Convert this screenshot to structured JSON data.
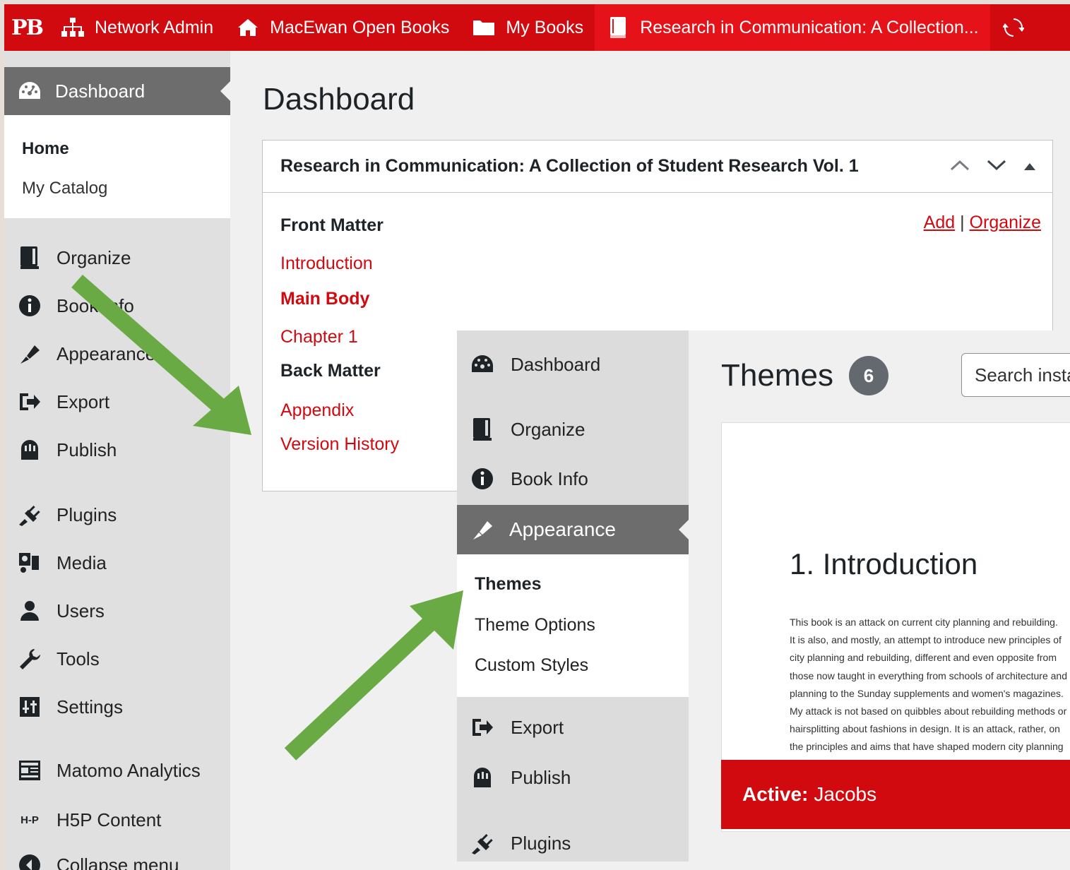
{
  "colors": {
    "brand": "#d10a10",
    "arrow": "#6aaa44",
    "menu_active": "#6d6d6d"
  },
  "adminbar": {
    "logo": "PB",
    "items": [
      {
        "label": "Network Admin",
        "icon": "sitemap-icon"
      },
      {
        "label": "MacEwan Open Books",
        "icon": "home-icon"
      },
      {
        "label": "My Books",
        "icon": "folder-icon"
      },
      {
        "label": "Research in Communication: A Collection...",
        "icon": "book-icon"
      }
    ],
    "trailing_icon": "sync-icon"
  },
  "sidebar": {
    "active": {
      "label": "Dashboard",
      "icon": "dashboard-icon"
    },
    "submenu": [
      "Home",
      "My Catalog"
    ],
    "items": [
      {
        "label": "Organize",
        "icon": "book-icon"
      },
      {
        "label": "Book Info",
        "icon": "info-icon"
      },
      {
        "label": "Appearance",
        "icon": "brush-icon"
      },
      {
        "label": "Export",
        "icon": "export-icon"
      },
      {
        "label": "Publish",
        "icon": "publish-icon"
      },
      {
        "label": "Plugins",
        "icon": "plugins-icon"
      },
      {
        "label": "Media",
        "icon": "media-icon"
      },
      {
        "label": "Users",
        "icon": "user-icon"
      },
      {
        "label": "Tools",
        "icon": "wrench-icon"
      },
      {
        "label": "Settings",
        "icon": "settings-icon"
      },
      {
        "label": "Matomo Analytics",
        "icon": "analytics-icon"
      },
      {
        "label": "H5P Content",
        "icon": "h5p-icon"
      },
      {
        "label": "Collapse menu",
        "icon": "collapse-icon"
      }
    ]
  },
  "main": {
    "title": "Dashboard",
    "widget": {
      "title": "Research in Communication: A Collection of Student Research Vol. 1",
      "links": {
        "add": "Add",
        "separator": "|",
        "organize": "Organize"
      },
      "rows": [
        {
          "text": "Front Matter",
          "style": "bold"
        },
        {
          "text": "Introduction",
          "style": "red"
        },
        {
          "text": "Main Body",
          "style": "red-bold"
        },
        {
          "text": "Chapter 1",
          "style": "red"
        },
        {
          "text": "Back Matter",
          "style": "bold"
        },
        {
          "text": "Appendix",
          "style": "red"
        },
        {
          "text": "Version History",
          "style": "red"
        }
      ]
    }
  },
  "overlay": {
    "menu": {
      "items_top": [
        {
          "label": "Dashboard",
          "icon": "dashboard-icon"
        },
        {
          "label": "Organize",
          "icon": "book-icon"
        },
        {
          "label": "Book Info",
          "icon": "info-icon"
        }
      ],
      "active": {
        "label": "Appearance",
        "icon": "brush-icon"
      },
      "submenu": [
        "Themes",
        "Theme Options",
        "Custom Styles"
      ],
      "items_bottom": [
        {
          "label": "Export",
          "icon": "export-icon"
        },
        {
          "label": "Publish",
          "icon": "publish-icon"
        },
        {
          "label": "Plugins",
          "icon": "plugins-icon"
        }
      ]
    },
    "themes": {
      "title": "Themes",
      "count": "6",
      "search_placeholder": "Search installed themes...",
      "card": {
        "heading": "1. Introduction",
        "text": "This book is an attack on current city planning and rebuilding.\nIt is also, and mostly, an attempt to introduce new principles of\ncity planning and rebuilding, different and even opposite from\nthose now taught in everything from schools of architecture and\nplanning to the Sunday supplements and women's magazines.\nMy attack is not based on quibbles about rebuilding methods or\nhairsplitting about fashions in design. It is an attack, rather, on\nthe principles and aims that have shaped modern city planning",
        "active_label": "Active:",
        "active_theme": "Jacobs"
      }
    }
  }
}
